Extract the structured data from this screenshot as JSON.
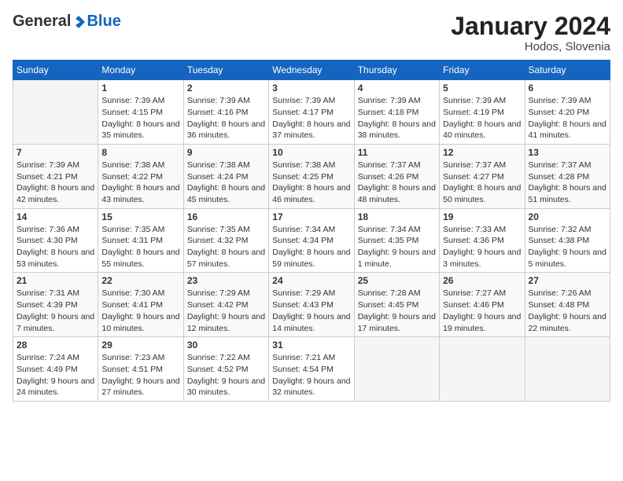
{
  "logo": {
    "general": "General",
    "blue": "Blue"
  },
  "title": "January 2024",
  "location": "Hodos, Slovenia",
  "days_of_week": [
    "Sunday",
    "Monday",
    "Tuesday",
    "Wednesday",
    "Thursday",
    "Friday",
    "Saturday"
  ],
  "weeks": [
    [
      {
        "day": "",
        "sunrise": "",
        "sunset": "",
        "daylight": ""
      },
      {
        "day": "1",
        "sunrise": "Sunrise: 7:39 AM",
        "sunset": "Sunset: 4:15 PM",
        "daylight": "Daylight: 8 hours and 35 minutes."
      },
      {
        "day": "2",
        "sunrise": "Sunrise: 7:39 AM",
        "sunset": "Sunset: 4:16 PM",
        "daylight": "Daylight: 8 hours and 36 minutes."
      },
      {
        "day": "3",
        "sunrise": "Sunrise: 7:39 AM",
        "sunset": "Sunset: 4:17 PM",
        "daylight": "Daylight: 8 hours and 37 minutes."
      },
      {
        "day": "4",
        "sunrise": "Sunrise: 7:39 AM",
        "sunset": "Sunset: 4:18 PM",
        "daylight": "Daylight: 8 hours and 38 minutes."
      },
      {
        "day": "5",
        "sunrise": "Sunrise: 7:39 AM",
        "sunset": "Sunset: 4:19 PM",
        "daylight": "Daylight: 8 hours and 40 minutes."
      },
      {
        "day": "6",
        "sunrise": "Sunrise: 7:39 AM",
        "sunset": "Sunset: 4:20 PM",
        "daylight": "Daylight: 8 hours and 41 minutes."
      }
    ],
    [
      {
        "day": "7",
        "sunrise": "Sunrise: 7:39 AM",
        "sunset": "Sunset: 4:21 PM",
        "daylight": "Daylight: 8 hours and 42 minutes."
      },
      {
        "day": "8",
        "sunrise": "Sunrise: 7:38 AM",
        "sunset": "Sunset: 4:22 PM",
        "daylight": "Daylight: 8 hours and 43 minutes."
      },
      {
        "day": "9",
        "sunrise": "Sunrise: 7:38 AM",
        "sunset": "Sunset: 4:24 PM",
        "daylight": "Daylight: 8 hours and 45 minutes."
      },
      {
        "day": "10",
        "sunrise": "Sunrise: 7:38 AM",
        "sunset": "Sunset: 4:25 PM",
        "daylight": "Daylight: 8 hours and 46 minutes."
      },
      {
        "day": "11",
        "sunrise": "Sunrise: 7:37 AM",
        "sunset": "Sunset: 4:26 PM",
        "daylight": "Daylight: 8 hours and 48 minutes."
      },
      {
        "day": "12",
        "sunrise": "Sunrise: 7:37 AM",
        "sunset": "Sunset: 4:27 PM",
        "daylight": "Daylight: 8 hours and 50 minutes."
      },
      {
        "day": "13",
        "sunrise": "Sunrise: 7:37 AM",
        "sunset": "Sunset: 4:28 PM",
        "daylight": "Daylight: 8 hours and 51 minutes."
      }
    ],
    [
      {
        "day": "14",
        "sunrise": "Sunrise: 7:36 AM",
        "sunset": "Sunset: 4:30 PM",
        "daylight": "Daylight: 8 hours and 53 minutes."
      },
      {
        "day": "15",
        "sunrise": "Sunrise: 7:35 AM",
        "sunset": "Sunset: 4:31 PM",
        "daylight": "Daylight: 8 hours and 55 minutes."
      },
      {
        "day": "16",
        "sunrise": "Sunrise: 7:35 AM",
        "sunset": "Sunset: 4:32 PM",
        "daylight": "Daylight: 8 hours and 57 minutes."
      },
      {
        "day": "17",
        "sunrise": "Sunrise: 7:34 AM",
        "sunset": "Sunset: 4:34 PM",
        "daylight": "Daylight: 8 hours and 59 minutes."
      },
      {
        "day": "18",
        "sunrise": "Sunrise: 7:34 AM",
        "sunset": "Sunset: 4:35 PM",
        "daylight": "Daylight: 9 hours and 1 minute."
      },
      {
        "day": "19",
        "sunrise": "Sunrise: 7:33 AM",
        "sunset": "Sunset: 4:36 PM",
        "daylight": "Daylight: 9 hours and 3 minutes."
      },
      {
        "day": "20",
        "sunrise": "Sunrise: 7:32 AM",
        "sunset": "Sunset: 4:38 PM",
        "daylight": "Daylight: 9 hours and 5 minutes."
      }
    ],
    [
      {
        "day": "21",
        "sunrise": "Sunrise: 7:31 AM",
        "sunset": "Sunset: 4:39 PM",
        "daylight": "Daylight: 9 hours and 7 minutes."
      },
      {
        "day": "22",
        "sunrise": "Sunrise: 7:30 AM",
        "sunset": "Sunset: 4:41 PM",
        "daylight": "Daylight: 9 hours and 10 minutes."
      },
      {
        "day": "23",
        "sunrise": "Sunrise: 7:29 AM",
        "sunset": "Sunset: 4:42 PM",
        "daylight": "Daylight: 9 hours and 12 minutes."
      },
      {
        "day": "24",
        "sunrise": "Sunrise: 7:29 AM",
        "sunset": "Sunset: 4:43 PM",
        "daylight": "Daylight: 9 hours and 14 minutes."
      },
      {
        "day": "25",
        "sunrise": "Sunrise: 7:28 AM",
        "sunset": "Sunset: 4:45 PM",
        "daylight": "Daylight: 9 hours and 17 minutes."
      },
      {
        "day": "26",
        "sunrise": "Sunrise: 7:27 AM",
        "sunset": "Sunset: 4:46 PM",
        "daylight": "Daylight: 9 hours and 19 minutes."
      },
      {
        "day": "27",
        "sunrise": "Sunrise: 7:26 AM",
        "sunset": "Sunset: 4:48 PM",
        "daylight": "Daylight: 9 hours and 22 minutes."
      }
    ],
    [
      {
        "day": "28",
        "sunrise": "Sunrise: 7:24 AM",
        "sunset": "Sunset: 4:49 PM",
        "daylight": "Daylight: 9 hours and 24 minutes."
      },
      {
        "day": "29",
        "sunrise": "Sunrise: 7:23 AM",
        "sunset": "Sunset: 4:51 PM",
        "daylight": "Daylight: 9 hours and 27 minutes."
      },
      {
        "day": "30",
        "sunrise": "Sunrise: 7:22 AM",
        "sunset": "Sunset: 4:52 PM",
        "daylight": "Daylight: 9 hours and 30 minutes."
      },
      {
        "day": "31",
        "sunrise": "Sunrise: 7:21 AM",
        "sunset": "Sunset: 4:54 PM",
        "daylight": "Daylight: 9 hours and 32 minutes."
      },
      {
        "day": "",
        "sunrise": "",
        "sunset": "",
        "daylight": ""
      },
      {
        "day": "",
        "sunrise": "",
        "sunset": "",
        "daylight": ""
      },
      {
        "day": "",
        "sunrise": "",
        "sunset": "",
        "daylight": ""
      }
    ]
  ]
}
